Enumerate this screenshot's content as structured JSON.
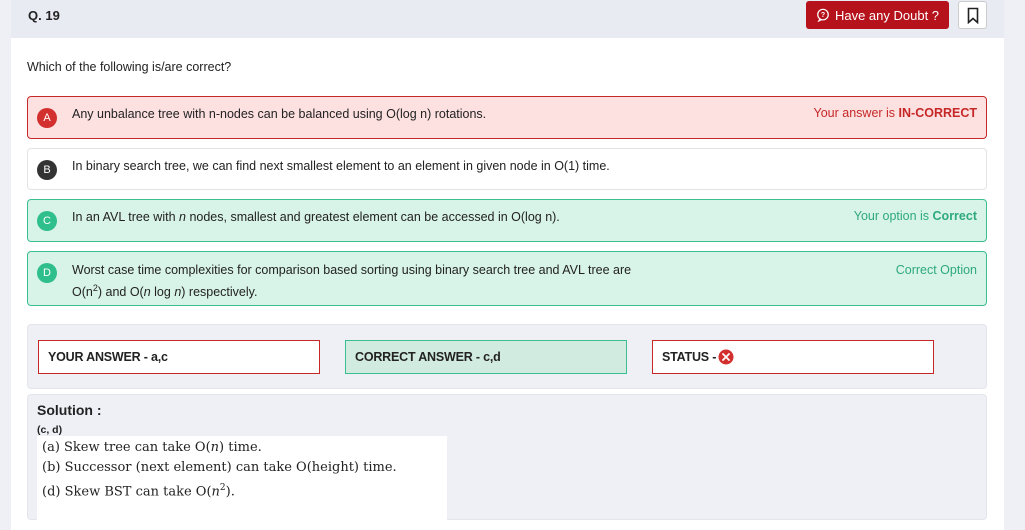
{
  "header": {
    "question_number": "Q. 19",
    "doubt_button_label": "Have any Doubt ?"
  },
  "question": "Which of the following is/are correct?",
  "options": [
    {
      "letter": "A",
      "text": "Any unbalance tree with n-nodes can be balanced using O(log n) rotations.",
      "status_prefix": "Your answer is ",
      "status_value": "IN-CORRECT"
    },
    {
      "letter": "B",
      "text": "In binary search tree, we can find next smallest element to an element in given node in O(1) time."
    },
    {
      "letter": "C",
      "text_pre": "In an AVL tree with ",
      "text_italic": "n",
      "text_post": " nodes, smallest and greatest element can be accessed in O(log n).",
      "status_prefix": "Your option is ",
      "status_value": "Correct"
    },
    {
      "letter": "D",
      "line1": "Worst case time complexities for comparison based sorting using binary search tree and AVL tree are",
      "line2_a": "O(n",
      "line2_sup": "2",
      "line2_b": ") and O(",
      "line2_i1": "n",
      "line2_c": " log ",
      "line2_i2": "n",
      "line2_d": ") respectively.",
      "status": "Correct Option"
    }
  ],
  "summary": {
    "your_answer": "YOUR ANSWER - a,c",
    "correct_answer": "CORRECT ANSWER - c,d",
    "status_label": "STATUS - "
  },
  "solution": {
    "title": "Solution :",
    "answer": "(c, d)",
    "line_a_pre": "(a)  Skew tree can take O(",
    "line_a_i": "n",
    "line_a_post": ") time.",
    "line_b": "(b)  Successor (next element) can take O(height) time.",
    "line_d_pre": "(d)  Skew BST can take O(",
    "line_d_i": "n",
    "line_d_sup": "2",
    "line_d_post": ")."
  },
  "colors": {
    "incorrect": "#c62828",
    "correct": "#2eaa7c",
    "badge_red": "#d32f2f",
    "badge_dark": "#333333",
    "badge_green": "#2fbf8c",
    "doubt_button": "#b5121b"
  },
  "icons": {
    "doubt": "doubt-bubble-icon",
    "bookmark": "bookmark-icon",
    "status_wrong": "cross-circle-icon"
  }
}
